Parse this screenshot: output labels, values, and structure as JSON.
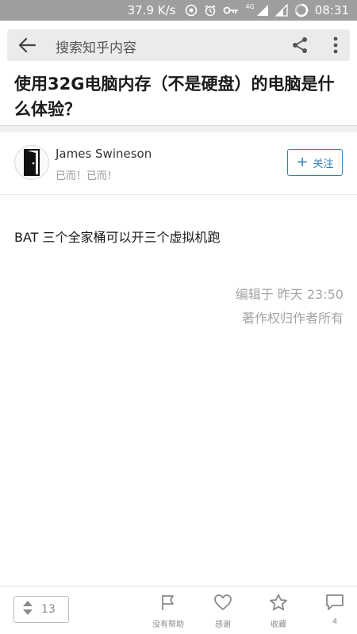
{
  "status_bar": {
    "network_speed": "37.9 K/s",
    "network_type": "4G",
    "time": "08:31"
  },
  "header": {
    "search_placeholder": "搜索知乎内容"
  },
  "question": {
    "title": "使用32G电脑内存（不是硬盘）的电脑是什么体验？"
  },
  "author": {
    "name": "James Swineson",
    "bio": "已而！已而！",
    "follow_label": "关注"
  },
  "answer": {
    "content": "BAT 三个全家桶可以开三个虚拟机跑",
    "edit_info": "编辑于 昨天 23:50",
    "copyright": "著作权归作者所有"
  },
  "bottom_bar": {
    "vote_count": "13",
    "no_help_label": "没有帮助",
    "thanks_label": "感谢",
    "collect_label": "收藏",
    "comment_count": "4"
  },
  "colors": {
    "status_bar": "#9e9e9e",
    "accent": "#2f7fbd",
    "meta_text": "#a5a5a5"
  }
}
